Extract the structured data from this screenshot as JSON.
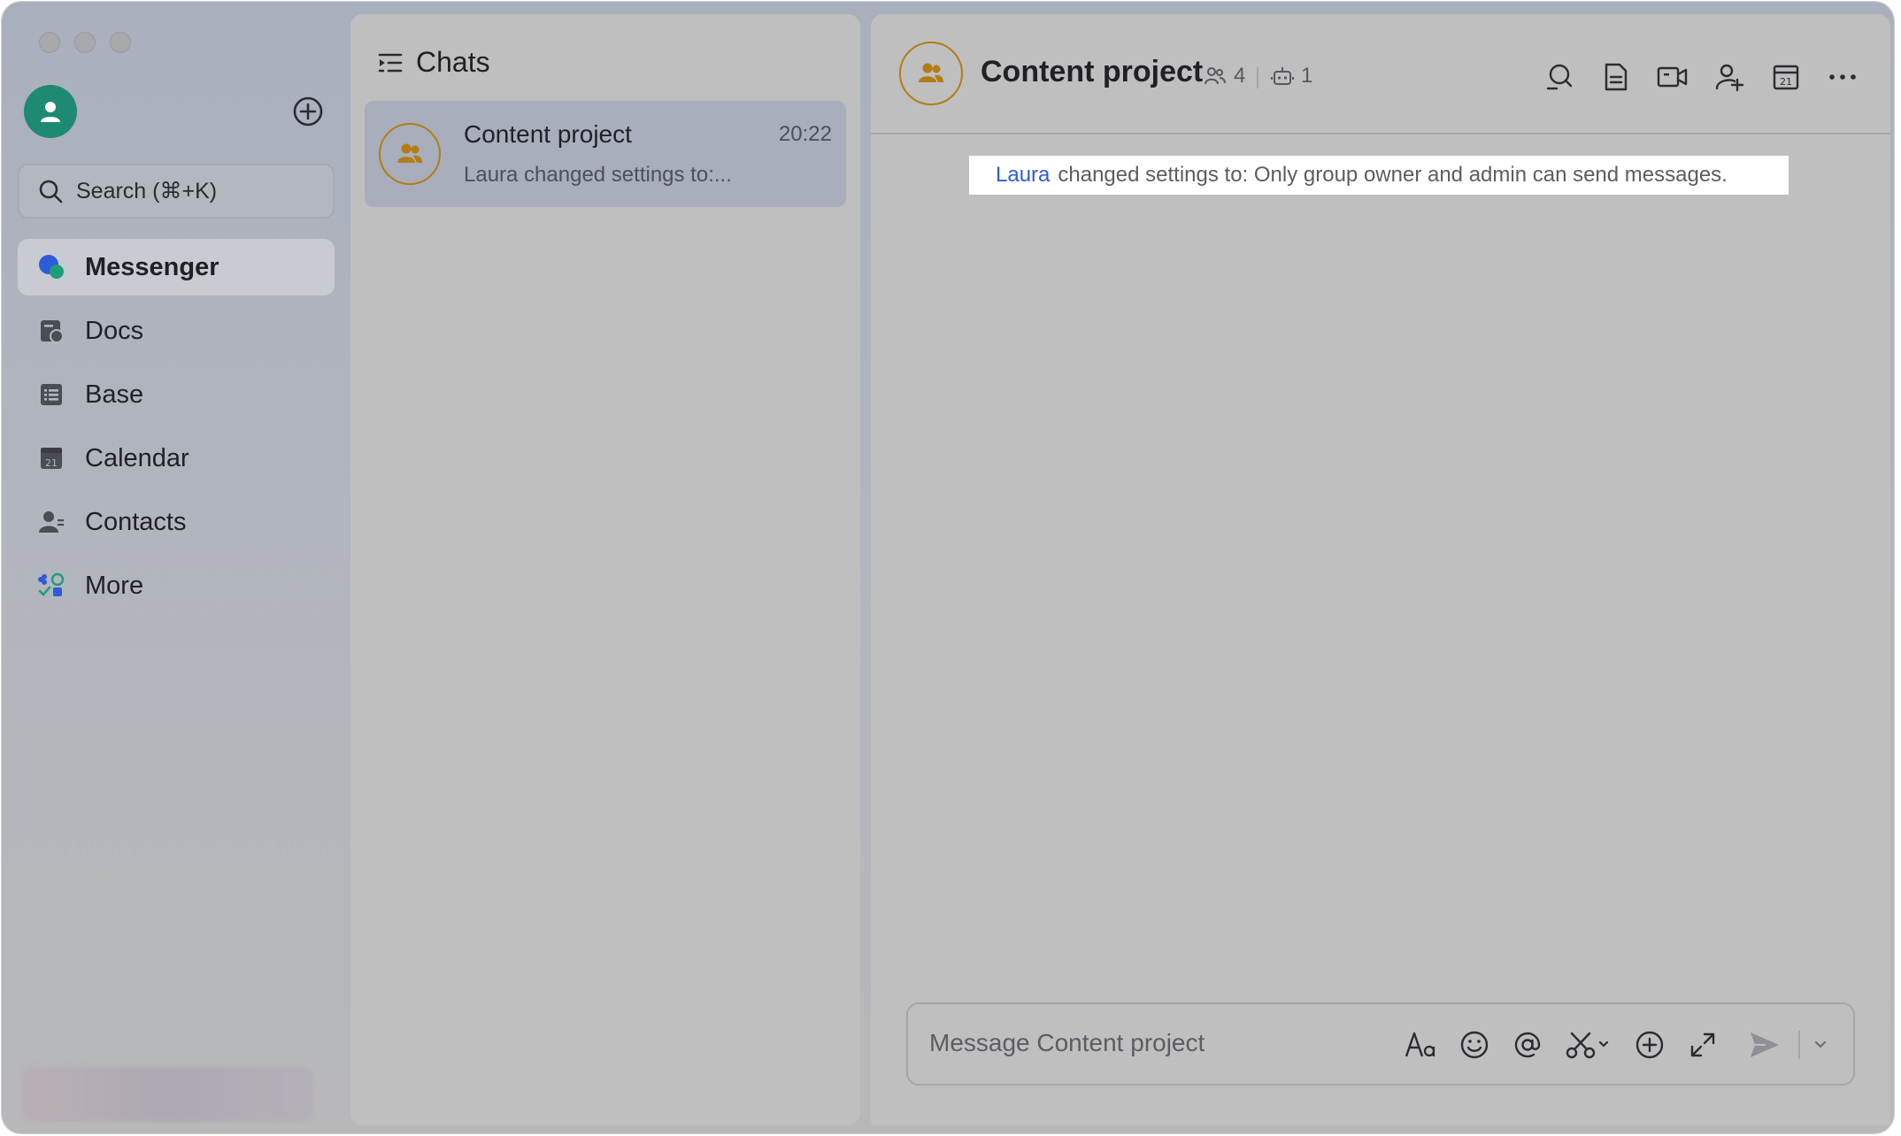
{
  "sidebar": {
    "search_label": "Search (⌘+K)",
    "nav": [
      {
        "label": "Messenger",
        "icon": "messenger-icon",
        "active": true
      },
      {
        "label": "Docs",
        "icon": "docs-icon"
      },
      {
        "label": "Base",
        "icon": "base-icon"
      },
      {
        "label": "Calendar",
        "icon": "calendar-icon"
      },
      {
        "label": "Contacts",
        "icon": "contacts-icon"
      },
      {
        "label": "More",
        "icon": "more-apps-icon"
      }
    ]
  },
  "chats": {
    "title": "Chats",
    "items": [
      {
        "name": "Content project",
        "time": "20:22",
        "preview": "Laura changed settings to:..."
      }
    ]
  },
  "conversation": {
    "title": "Content project",
    "member_count": "4",
    "bot_count": "1",
    "system_message": {
      "actor": "Laura",
      "text": "changed settings to: Only group owner and admin can send messages."
    },
    "composer": {
      "placeholder": "Message Content project"
    }
  },
  "colors": {
    "accent_avatar": "#1e8a72",
    "group_avatar_ring": "#b47d14",
    "link": "#2f5bd8"
  }
}
